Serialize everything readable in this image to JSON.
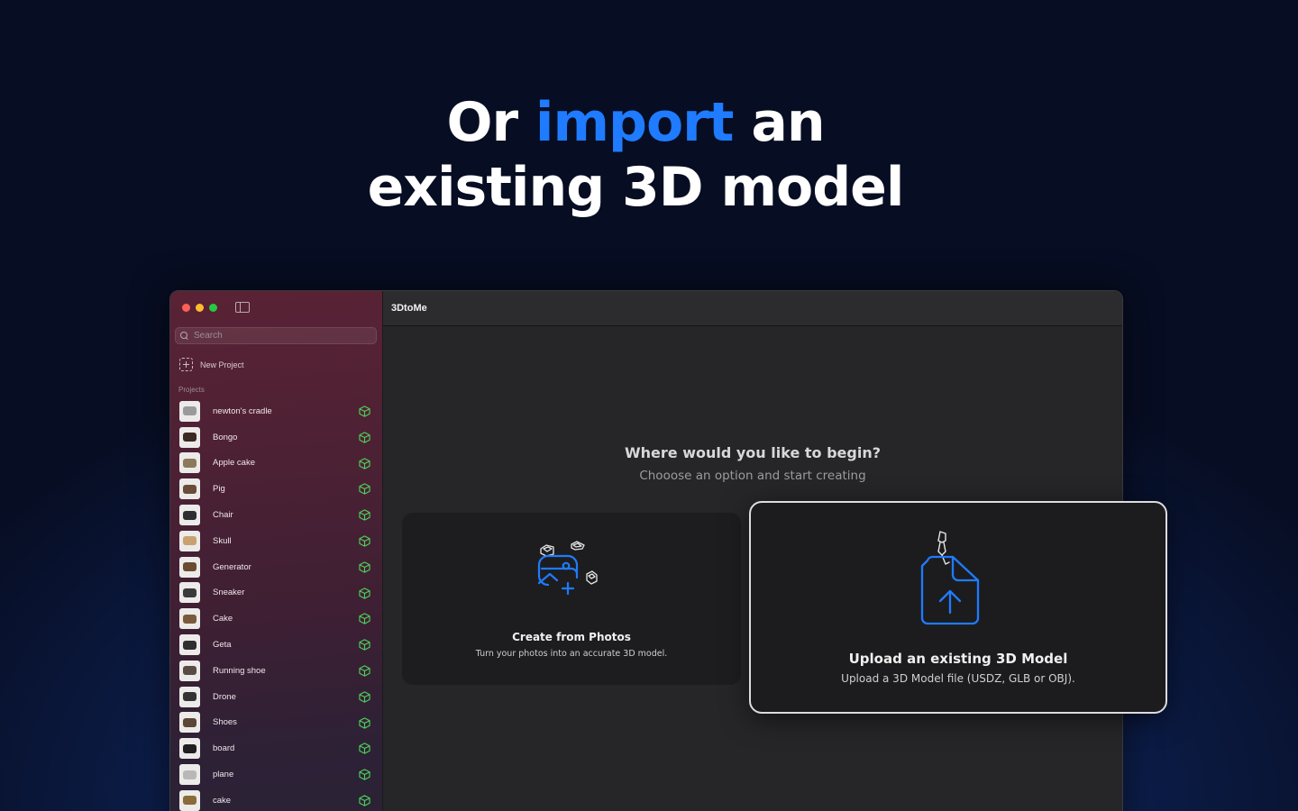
{
  "headline": {
    "prefix": "Or ",
    "accent": "import",
    "suffix": " an",
    "line2": "existing 3D model"
  },
  "colors": {
    "accent": "#1f7bff",
    "cube_icon": "#4fd15a"
  },
  "window": {
    "title": "3DtoMe"
  },
  "sidebar": {
    "search_placeholder": "Search",
    "new_project_label": "New Project",
    "section_label": "Projects",
    "projects": [
      {
        "name": "newton's cradle",
        "thumb": "#9a9a9a"
      },
      {
        "name": "Bongo",
        "thumb": "#3b2a22"
      },
      {
        "name": "Apple cake",
        "thumb": "#8c7a5c"
      },
      {
        "name": "Pig",
        "thumb": "#6b4b3a"
      },
      {
        "name": "Chair",
        "thumb": "#2e2e32"
      },
      {
        "name": "Skull",
        "thumb": "#c9a070"
      },
      {
        "name": "Generator",
        "thumb": "#6a4a30"
      },
      {
        "name": "Sneaker",
        "thumb": "#3a3a3a"
      },
      {
        "name": "Cake",
        "thumb": "#7a5a3c"
      },
      {
        "name": "Geta",
        "thumb": "#2f2f2f"
      },
      {
        "name": "Running shoe",
        "thumb": "#5a4a44"
      },
      {
        "name": "Drone",
        "thumb": "#333333"
      },
      {
        "name": "Shoes",
        "thumb": "#5c4636"
      },
      {
        "name": "board",
        "thumb": "#202020"
      },
      {
        "name": "plane",
        "thumb": "#b8b8b8"
      },
      {
        "name": "cake",
        "thumb": "#8a6a3a"
      }
    ]
  },
  "main": {
    "prompt_title": "Where would you like to begin?",
    "prompt_subtitle": "Chooose an option and start creating",
    "cards": {
      "photos": {
        "title": "Create from Photos",
        "description": "Turn your photos into an accurate 3D model.",
        "icon": "photo-to-model-icon"
      },
      "upload": {
        "title": "Upload an existing 3D Model",
        "description": "Upload a 3D Model file (USDZ, GLB or OBJ).",
        "icon": "upload-file-icon"
      }
    }
  }
}
